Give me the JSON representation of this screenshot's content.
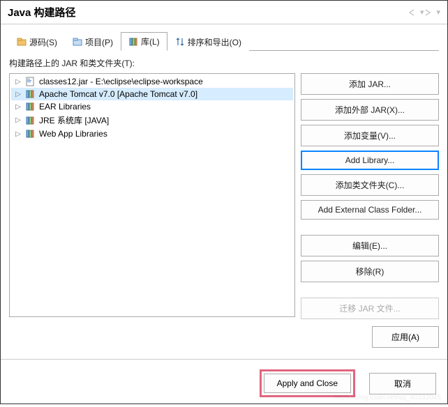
{
  "title": "Java 构建路径",
  "tabs": [
    {
      "label": "源码(S)"
    },
    {
      "label": "项目(P)"
    },
    {
      "label": "库(L)"
    },
    {
      "label": "排序和导出(O)"
    }
  ],
  "pane_label": "构建路径上的 JAR 和类文件夹(T):",
  "tree": [
    {
      "label": "classes12.jar - E:\\eclipse\\eclipse-workspace",
      "icon": "jar",
      "selected": false
    },
    {
      "label": "Apache Tomcat v7.0 [Apache Tomcat v7.0]",
      "icon": "lib",
      "selected": true
    },
    {
      "label": "EAR Libraries",
      "icon": "lib",
      "selected": false
    },
    {
      "label": "JRE 系统库 [JAVA]",
      "icon": "lib",
      "selected": false
    },
    {
      "label": "Web App Libraries",
      "icon": "lib",
      "selected": false
    }
  ],
  "buttons": {
    "add_jar": "添加 JAR...",
    "add_external_jar": "添加外部 JAR(X)...",
    "add_variable": "添加变量(V)...",
    "add_library": "Add Library...",
    "add_class_folder": "添加类文件夹(C)...",
    "add_ext_class_folder": "Add External Class Folder...",
    "edit": "编辑(E)...",
    "remove": "移除(R)",
    "migrate": "迁移 JAR 文件..."
  },
  "apply": "应用(A)",
  "apply_close": "Apply and Close",
  "cancel": "取消",
  "watermark": "https://blog.csdn.net/qq_40332045"
}
